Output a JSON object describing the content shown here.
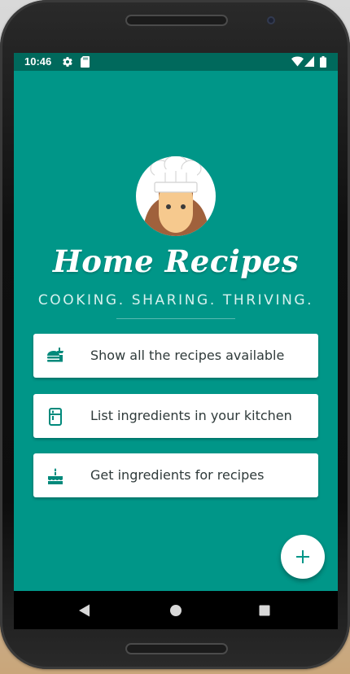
{
  "status_bar": {
    "time": "10:46",
    "icons": [
      "gear-icon",
      "sd-card-icon",
      "wifi-icon",
      "signal-icon",
      "battery-icon"
    ]
  },
  "app": {
    "title": "Home Recipes",
    "subtitle": "COOKING. SHARING. THRIVING.",
    "avatar": "chef-avatar"
  },
  "menu": [
    {
      "label": "Show all the recipes available",
      "icon": "food-icon"
    },
    {
      "label": "List ingredients in your kitchen",
      "icon": "fridge-icon"
    },
    {
      "label": "Get ingredients for recipes",
      "icon": "cake-icon"
    }
  ],
  "fab": {
    "icon": "add-icon"
  },
  "nav": {
    "icons": [
      "back-icon",
      "home-icon",
      "recents-icon"
    ]
  },
  "colors": {
    "primary": "#009688",
    "primary_dark": "#00695c",
    "card": "#ffffff",
    "text": "#2f3a3a"
  }
}
